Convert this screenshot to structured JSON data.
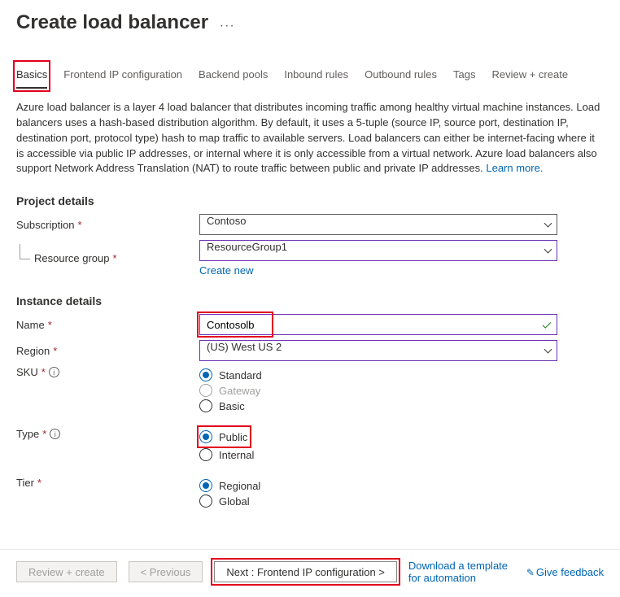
{
  "header": {
    "title": "Create load balancer"
  },
  "tabs": {
    "basics": "Basics",
    "frontend": "Frontend IP configuration",
    "backend": "Backend pools",
    "inbound": "Inbound rules",
    "outbound": "Outbound rules",
    "tags": "Tags",
    "review": "Review + create"
  },
  "description": "Azure load balancer is a layer 4 load balancer that distributes incoming traffic among healthy virtual machine instances. Load balancers uses a hash-based distribution algorithm. By default, it uses a 5-tuple (source IP, source port, destination IP, destination port, protocol type) hash to map traffic to available servers. Load balancers can either be internet-facing where it is accessible via public IP addresses, or internal where it is only accessible from a virtual network. Azure load balancers also support Network Address Translation (NAT) to route traffic between public and private IP addresses.  ",
  "learn_more": "Learn more.",
  "project": {
    "section": "Project details",
    "subscription_label": "Subscription",
    "subscription_value": "Contoso",
    "rg_label": "Resource group",
    "rg_value": "ResourceGroup1",
    "create_new": "Create new"
  },
  "instance": {
    "section": "Instance details",
    "name_label": "Name",
    "name_value": "Contosolb",
    "region_label": "Region",
    "region_value": "(US) West US 2",
    "sku_label": "SKU",
    "sku_standard": "Standard",
    "sku_gateway": "Gateway",
    "sku_basic": "Basic",
    "type_label": "Type",
    "type_public": "Public",
    "type_internal": "Internal",
    "tier_label": "Tier",
    "tier_regional": "Regional",
    "tier_global": "Global"
  },
  "footer": {
    "review": "Review + create",
    "previous": "< Previous",
    "next": "Next : Frontend IP configuration >",
    "download": "Download a template for automation",
    "feedback": "Give feedback"
  },
  "required_marker": "*",
  "info_glyph": "i"
}
